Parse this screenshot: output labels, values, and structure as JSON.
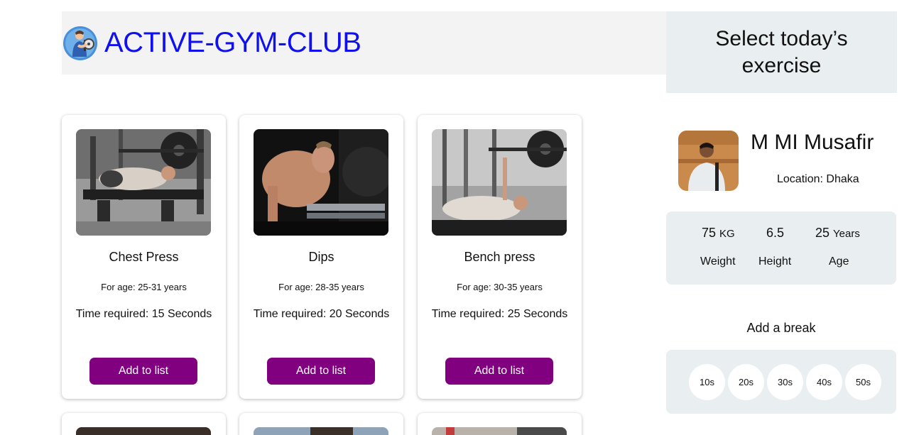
{
  "header": {
    "logo_icon": "weightlifter-logo-icon",
    "brand": "ACTIVE-GYM-CLUB"
  },
  "exercises": [
    {
      "title": "Chest Press",
      "age": "For age: 25-31 years",
      "time": "Time required: 15 Seconds",
      "button": "Add to list",
      "image": "chest-press-photo"
    },
    {
      "title": "Dips",
      "age": "For age: 28-35 years",
      "time": "Time required: 20 Seconds",
      "button": "Add to list",
      "image": "dips-photo"
    },
    {
      "title": "Bench press",
      "age": "For age: 30-35 years",
      "time": "Time required: 25 Seconds",
      "button": "Add to list",
      "image": "bench-press-photo"
    }
  ],
  "sidebar": {
    "heading": "Select today’s exercise",
    "profile": {
      "name": "M MI Musafir",
      "location": "Location: Dhaka"
    },
    "stats": [
      {
        "value": "75",
        "unit": "KG",
        "label": "Weight"
      },
      {
        "value": "6.5",
        "unit": "",
        "label": "Height"
      },
      {
        "value": "25",
        "unit": "Years",
        "label": "Age"
      }
    ],
    "break_title": "Add a break",
    "breaks": [
      "10s",
      "20s",
      "30s",
      "40s",
      "50s"
    ]
  },
  "colors": {
    "brand": "#1010ee",
    "button": "#800080",
    "panel": "#e9eef1",
    "header_bg": "#f3f3f3"
  }
}
